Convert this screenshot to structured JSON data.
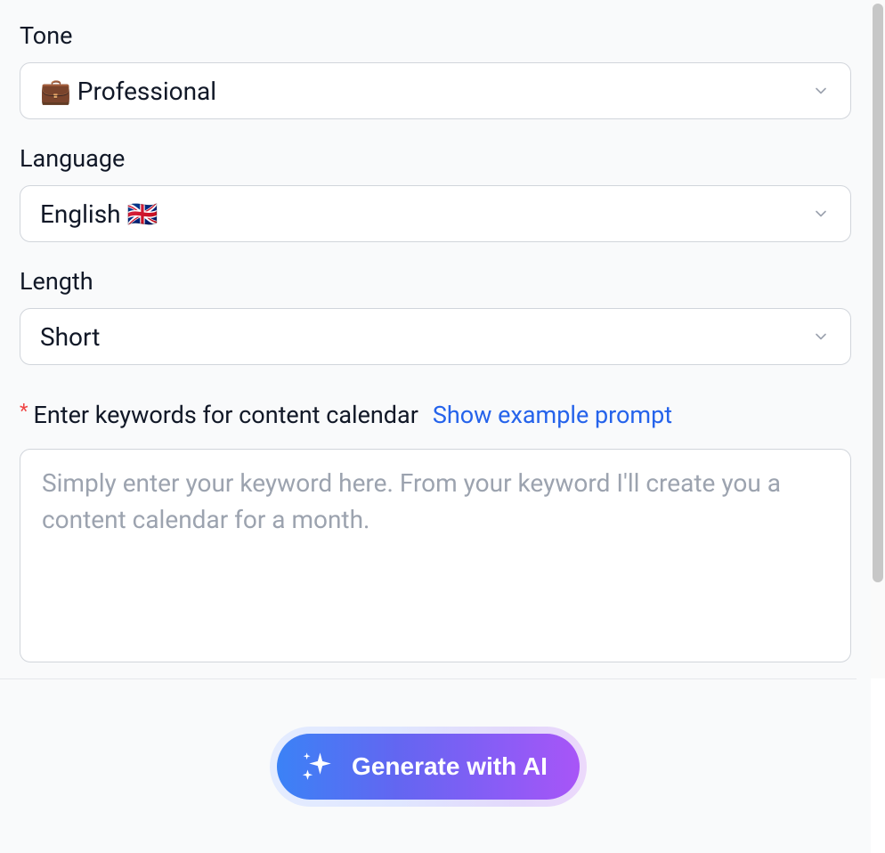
{
  "form": {
    "tone": {
      "label": "Tone",
      "value": "💼 Professional"
    },
    "language": {
      "label": "Language",
      "value": "English 🇬🇧"
    },
    "length": {
      "label": "Length",
      "value": "Short"
    },
    "keywords": {
      "required_mark": "*",
      "label": "Enter keywords for content calendar",
      "example_link": "Show example prompt",
      "placeholder": "Simply enter your keyword here. From your keyword I'll create you a content calendar for a month.",
      "value": ""
    }
  },
  "actions": {
    "generate_label": "Generate with AI"
  }
}
